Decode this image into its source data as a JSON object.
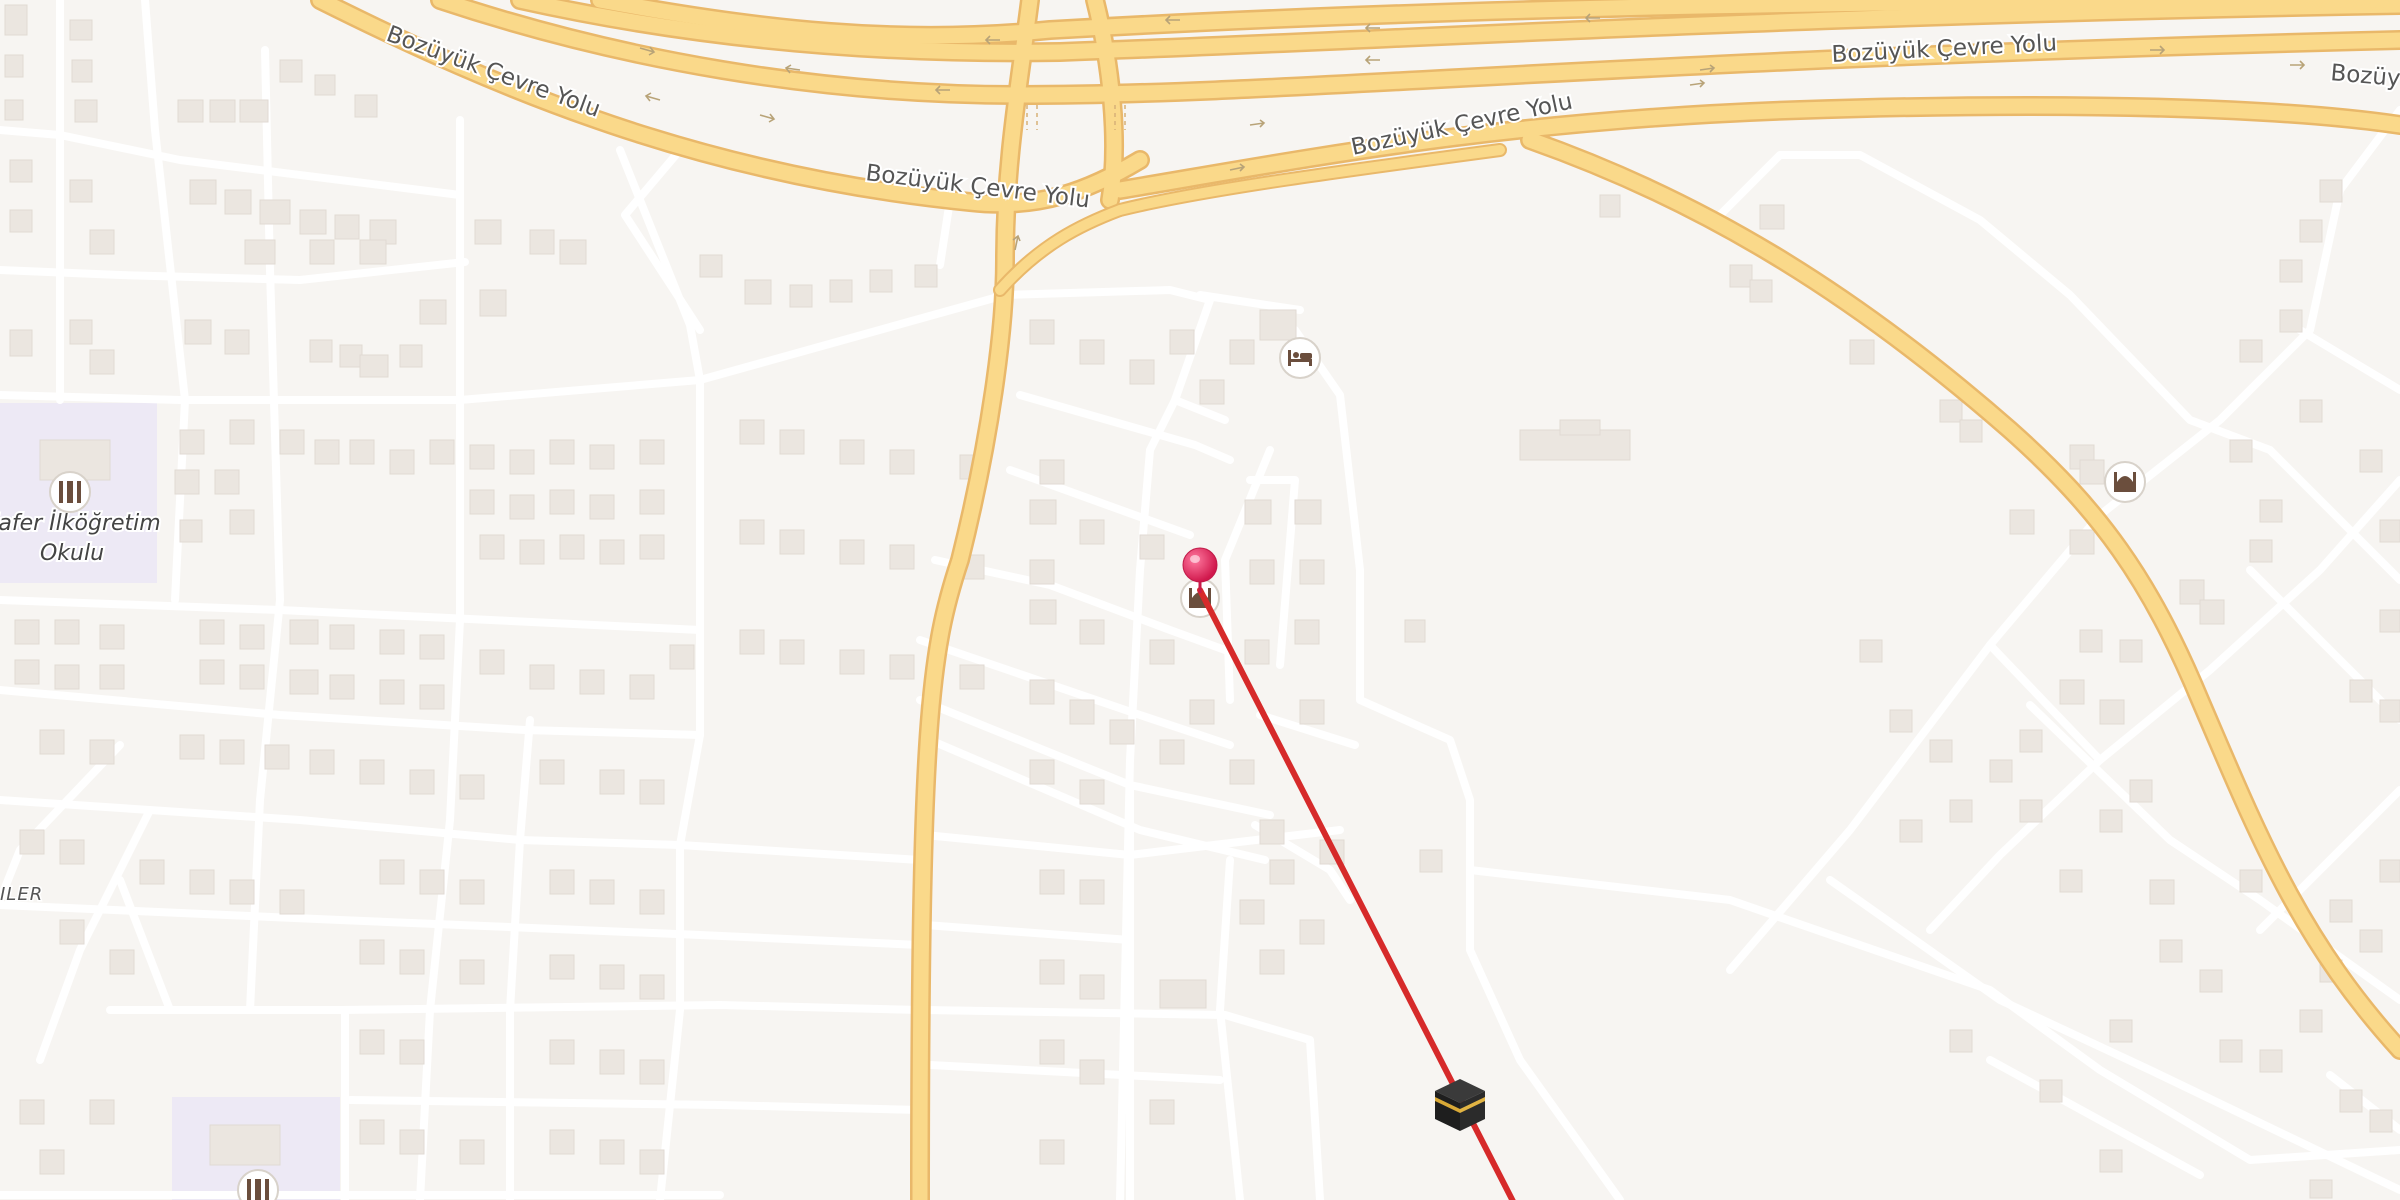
{
  "map": {
    "roads": {
      "ring_road_name": "Bozüyük Çevre Yolu"
    },
    "labels": {
      "school_line1": "Zafer İlköğretim",
      "school_line2": "Okulu",
      "district_partial": "ILER"
    },
    "pois": [
      {
        "type": "school",
        "icon": "school-icon"
      },
      {
        "type": "school",
        "icon": "school-icon"
      },
      {
        "type": "hotel",
        "icon": "bed-icon"
      },
      {
        "type": "mosque",
        "icon": "mosque-icon"
      },
      {
        "type": "mosque",
        "icon": "mosque-icon"
      }
    ],
    "marker": {
      "icon": "location-pin-icon",
      "color": "#e8245a"
    },
    "qibla": {
      "icon": "kaaba-icon",
      "line_color": "#d62a2a"
    },
    "colors": {
      "background": "#f2efe9",
      "block": "#f7f5f2",
      "street": "#ffffff",
      "building": "#ece7e2",
      "major_road": "#fad98a",
      "major_road_casing": "#e9b86a",
      "school_area": "#ede9f5"
    }
  }
}
